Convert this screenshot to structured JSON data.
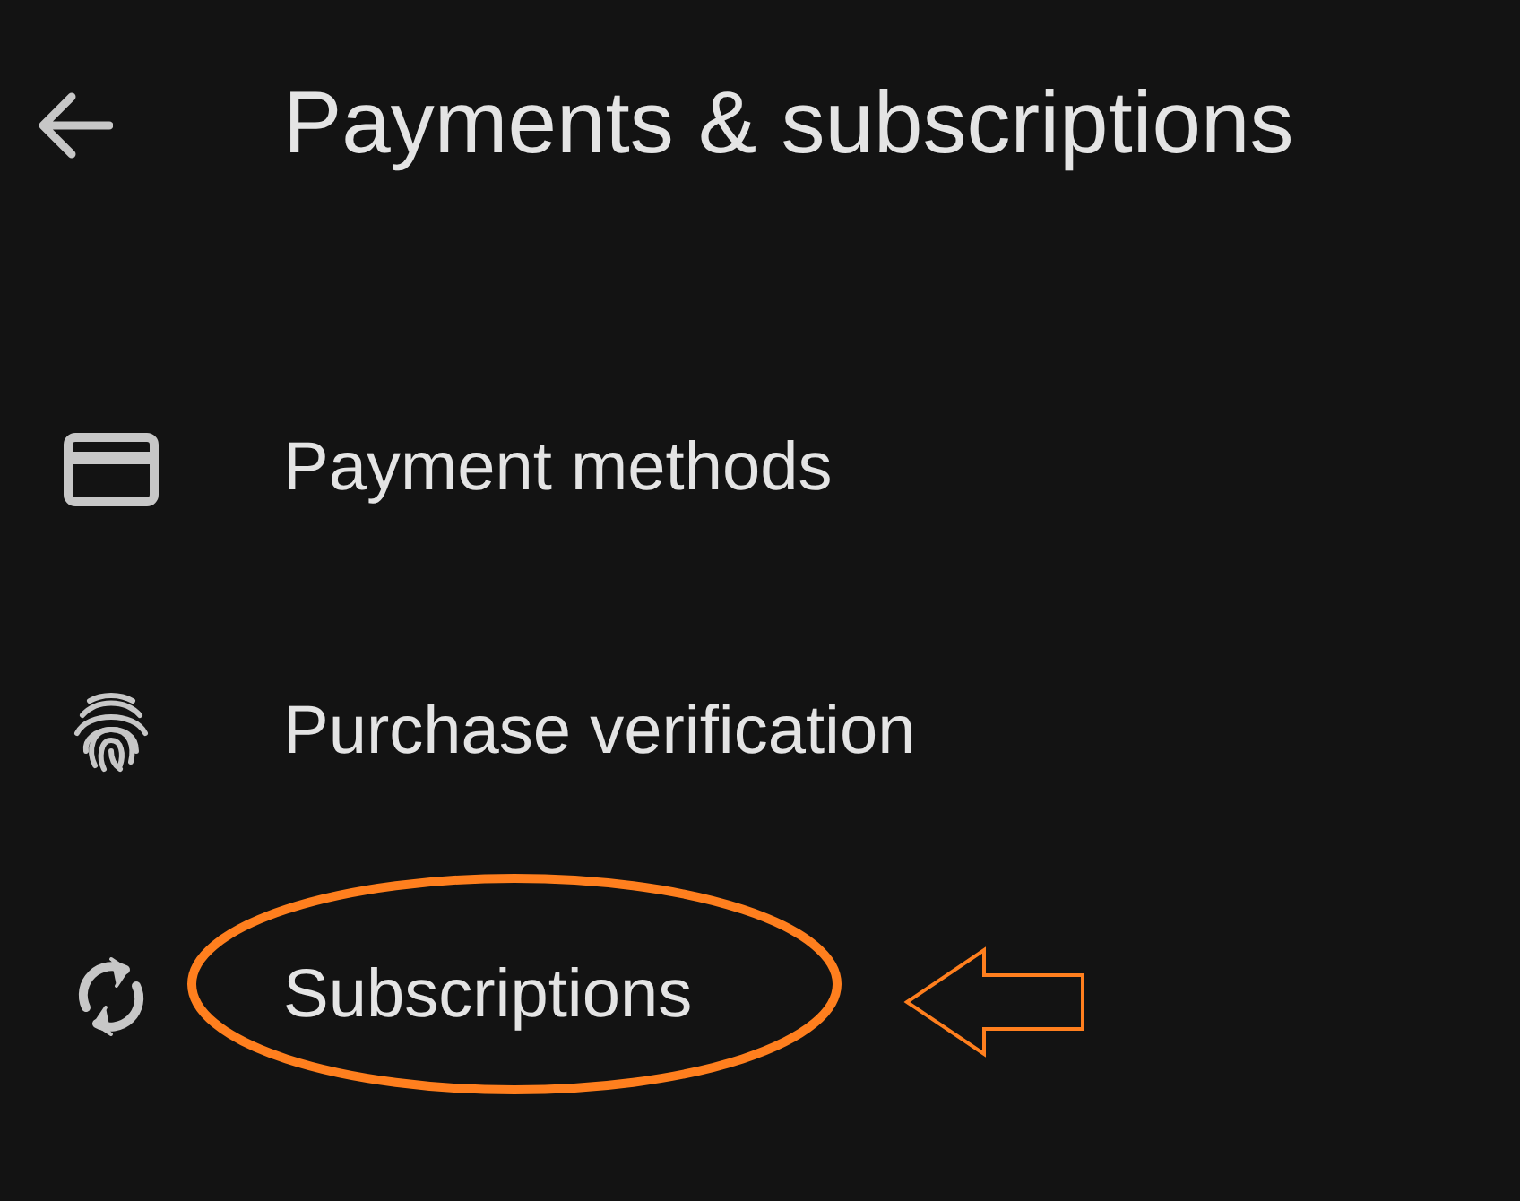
{
  "header": {
    "title": "Payments & subscriptions"
  },
  "items": [
    {
      "kind": "card",
      "label": "Payment methods",
      "highlighted": false
    },
    {
      "kind": "fingerprint",
      "label": "Purchase verification",
      "highlighted": false
    },
    {
      "kind": "sync",
      "label": "Subscriptions",
      "highlighted": true
    }
  ]
}
